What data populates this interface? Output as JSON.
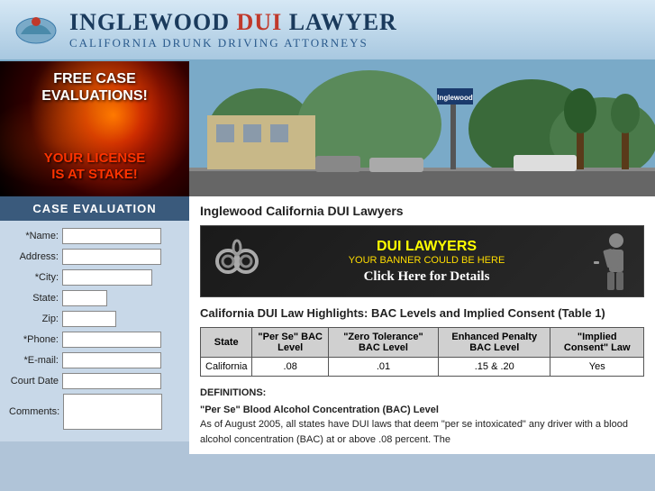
{
  "header": {
    "title_prefix": "Inglewood ",
    "title_dui": "DUI",
    "title_suffix": " Lawyer",
    "subtitle": "California Drunk Driving Attorneys",
    "logo_alt": "California map icon"
  },
  "sidebar": {
    "hero": {
      "line1": "FREE CASE",
      "line2": "EVALUATIONS!",
      "line3": "YOUR LICENSE",
      "line4": "IS AT STAKE!"
    },
    "case_eval_label": "CASE EVALUATION",
    "form": {
      "name_label": "*Name:",
      "address_label": "Address:",
      "city_label": "*City:",
      "state_label": "State:",
      "zip_label": "Zip:",
      "phone_label": "*Phone:",
      "email_label": "*E-mail:",
      "court_date_label": "Court Date",
      "comments_label": "Comments:"
    }
  },
  "content": {
    "page_title": "Inglewood California DUI Lawyers",
    "banner": {
      "title": "DUI LAWYERS",
      "subtitle": "YOUR BANNER COULD BE HERE",
      "cta": "Click Here for Details"
    },
    "table_section": {
      "title": "California DUI Law Highlights: BAC Levels and Implied Consent (Table 1)",
      "headers": [
        "State",
        "\"Per Se\" BAC Level",
        "\"Zero Tolerance\" BAC Level",
        "Enhanced Penalty BAC Level",
        "\"Implied Consent\" Law"
      ],
      "rows": [
        [
          "California",
          ".08",
          ".01",
          ".15 & .20",
          "Yes"
        ]
      ]
    },
    "definitions": {
      "title": "DEFINITIONS:",
      "per_se_title": "\"Per Se\" Blood Alcohol Concentration (BAC) Level",
      "per_se_text": "As of August 2005, all states have DUI laws that deem \"per se intoxicated\" any driver with a blood alcohol concentration (BAC) at or above .08 percent. The"
    },
    "street_sign_text": "Inglewood"
  }
}
